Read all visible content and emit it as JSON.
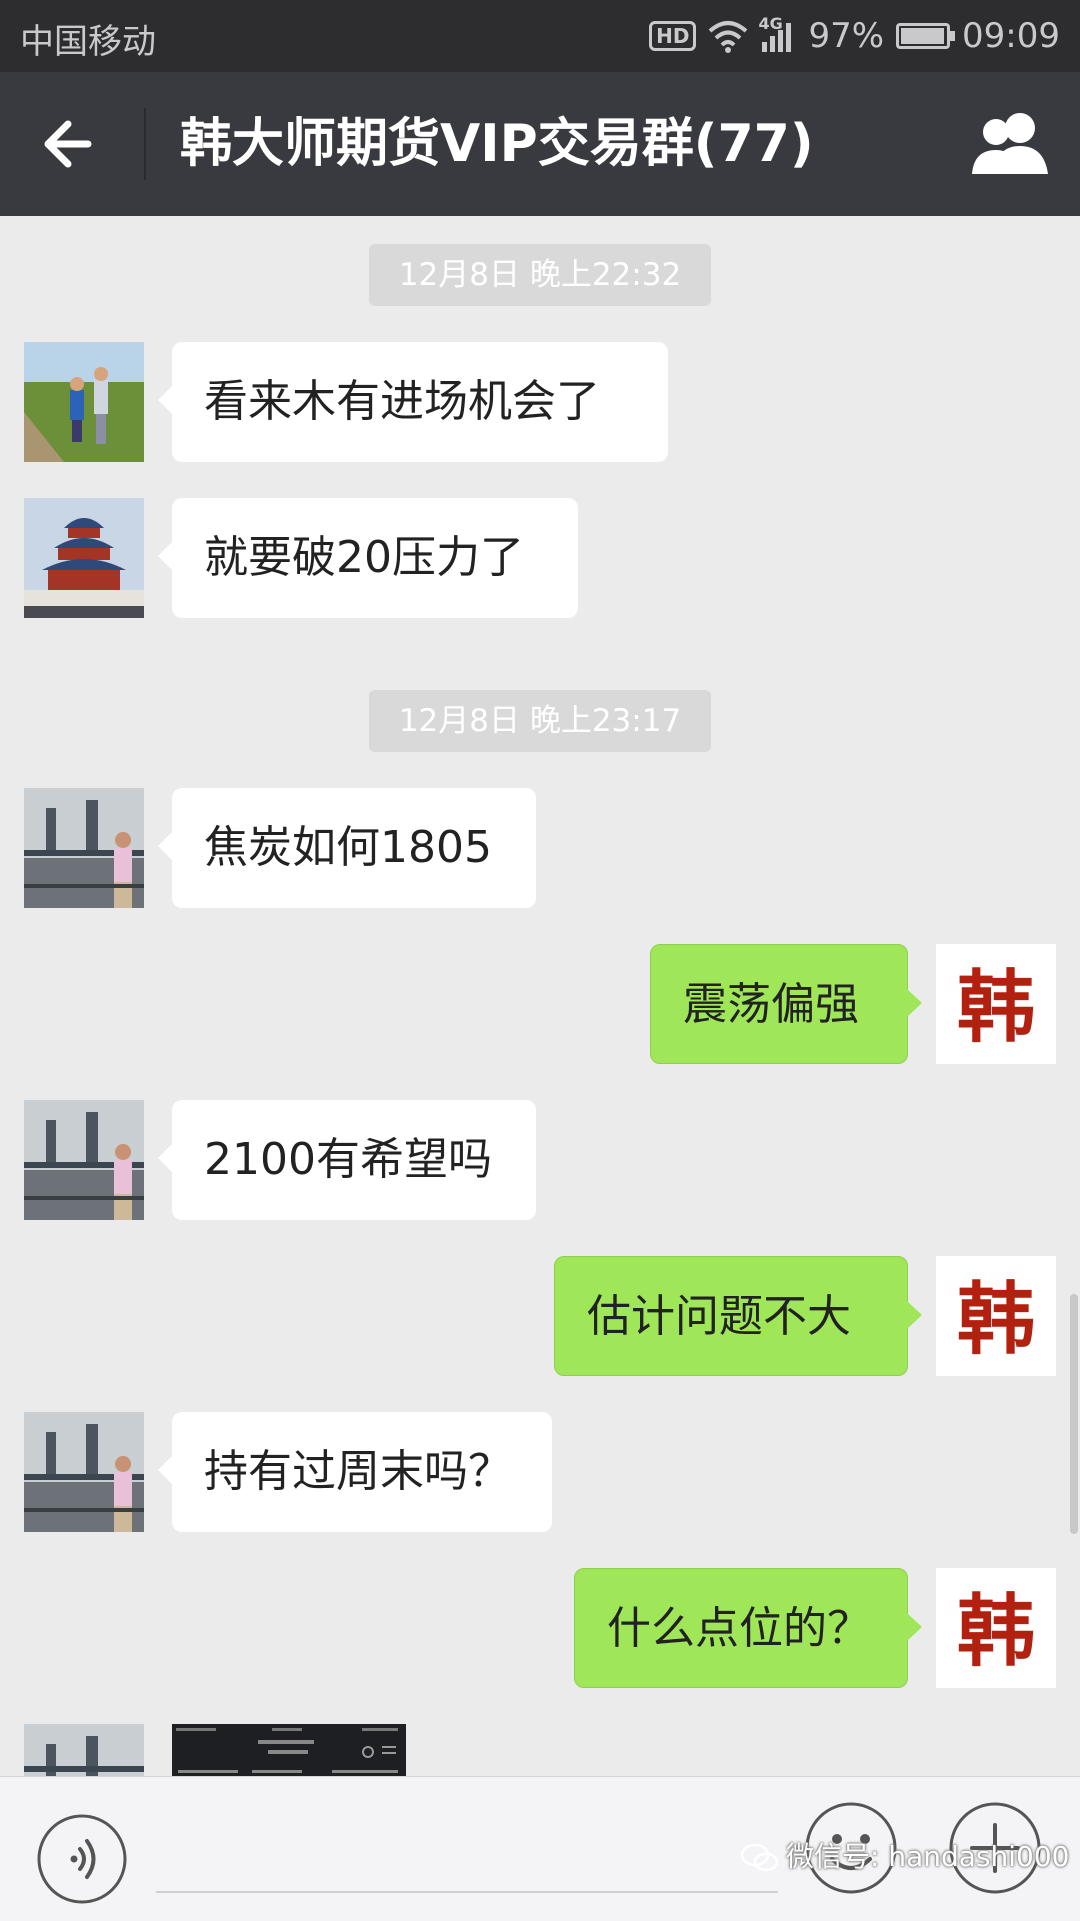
{
  "status_bar": {
    "carrier": "中国移动",
    "hd_label": "HD",
    "network_label": "4G",
    "battery_percent": "97%",
    "battery_level": 0.97,
    "time": "09:09"
  },
  "nav": {
    "title": "韩大师期货VIP交易群(77)"
  },
  "chat": {
    "time_labels": [
      "12月8日 晚上22:32",
      "12月8日 晚上23:17"
    ],
    "messages": [
      {
        "side": "left",
        "avatar": "field-photo-avatar",
        "text": "看来木有进场机会了"
      },
      {
        "side": "left",
        "avatar": "temple-photo-avatar",
        "text": "就要破20压力了"
      },
      {
        "side": "left",
        "avatar": "bridge-photo-avatar",
        "text": "焦炭如何1805"
      },
      {
        "side": "right",
        "avatar": "han-calligraphy-avatar",
        "text": "震荡偏强"
      },
      {
        "side": "left",
        "avatar": "bridge-photo-avatar",
        "text": "2100有希望吗"
      },
      {
        "side": "right",
        "avatar": "han-calligraphy-avatar",
        "text": "估计问题不大"
      },
      {
        "side": "left",
        "avatar": "bridge-photo-avatar",
        "text": "持有过周末吗？"
      },
      {
        "side": "right",
        "avatar": "han-calligraphy-avatar",
        "text": "什么点位的？"
      }
    ],
    "han_char": "韩"
  },
  "input_bar": {
    "watermark": "微信号: handashi000"
  },
  "colors": {
    "nav_bg": "#393a3f",
    "chat_bg": "#ebebeb",
    "bubble_right": "#9fe658",
    "bubble_left": "#ffffff",
    "han_red": "#b22010"
  },
  "icons": [
    "back-arrow-icon",
    "group-people-icon",
    "voice-icon",
    "emoji-icon",
    "plus-icon",
    "wifi-icon",
    "signal-icon",
    "battery-icon",
    "wechat-icon"
  ]
}
